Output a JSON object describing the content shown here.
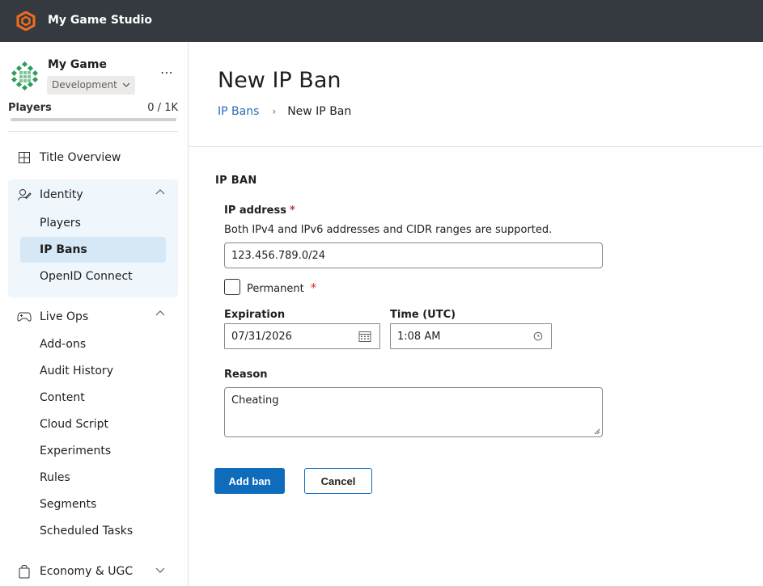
{
  "app": {
    "title": "My Game Studio",
    "logo_icon": "studio-logo-icon",
    "accent": "#0f6cbd",
    "topbar_color": "#343a40"
  },
  "sidebar": {
    "game_name": "My Game",
    "environment": "Development",
    "more": "⋯",
    "players_label": "Players",
    "players_count": "0 / 1K",
    "players_progress": 0,
    "nav": [
      {
        "label": "Title Overview",
        "icon": "grid-icon"
      },
      {
        "label": "Identity",
        "icon": "identity-icon",
        "expanded": true,
        "items": [
          {
            "label": "Players"
          },
          {
            "label": "IP Bans",
            "active": true
          },
          {
            "label": "OpenID Connect"
          }
        ]
      },
      {
        "label": "Live Ops",
        "icon": "gamepad-icon",
        "expanded": true,
        "items": [
          {
            "label": "Add-ons"
          },
          {
            "label": "Audit History"
          },
          {
            "label": "Content"
          },
          {
            "label": "Cloud Script"
          },
          {
            "label": "Experiments"
          },
          {
            "label": "Rules"
          },
          {
            "label": "Segments"
          },
          {
            "label": "Scheduled Tasks"
          }
        ]
      },
      {
        "label": "Economy & UGC",
        "icon": "shopping-bag-icon",
        "expanded": false
      }
    ]
  },
  "main": {
    "title": "New IP Ban",
    "breadcrumb": {
      "parent": "IP Bans",
      "separator": "›",
      "current": "New IP Ban"
    },
    "form": {
      "section_title": "IP BAN",
      "ip_label": "IP address",
      "required_mark": "*",
      "ip_help": "Both IPv4 and IPv6 addresses and CIDR ranges are supported.",
      "ip_value": "123.456.789.0/24",
      "permanent_label": "Permanent",
      "permanent_checked": false,
      "expiration_label": "Expiration",
      "expiration_value": "07/31/2026",
      "time_label": "Time (UTC)",
      "time_value": "1:08 AM",
      "reason_label": "Reason",
      "reason_value": "Cheating",
      "add_button": "Add ban",
      "cancel_button": "Cancel"
    }
  }
}
